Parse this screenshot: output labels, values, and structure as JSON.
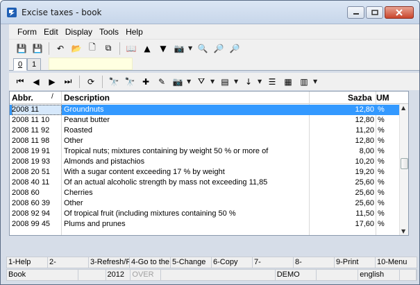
{
  "window": {
    "title": "Excise taxes - book"
  },
  "menu": [
    "Form",
    "Edit",
    "Display",
    "Tools",
    "Help"
  ],
  "toolbar1": [
    {
      "icon": "save-icon",
      "glyph": "💾",
      "enabled": false
    },
    {
      "icon": "save-as-icon",
      "glyph": "💾",
      "enabled": false
    },
    {
      "icon": "undo-icon",
      "glyph": "↶",
      "enabled": true
    },
    {
      "icon": "open-folder-icon",
      "glyph": "📂",
      "enabled": true
    },
    {
      "icon": "new-document-icon",
      "glyph": "🗋",
      "enabled": true
    },
    {
      "icon": "copy-icon",
      "glyph": "⧉",
      "enabled": true
    },
    {
      "icon": "book-icon",
      "glyph": "📖",
      "enabled": true
    },
    {
      "icon": "move-up-icon",
      "glyph": "▲",
      "enabled": true
    },
    {
      "icon": "move-down-icon",
      "glyph": "▼",
      "enabled": true
    },
    {
      "icon": "camera-icon",
      "glyph": "📷",
      "enabled": true
    },
    {
      "icon": "find-icon",
      "glyph": "🔍",
      "enabled": true
    },
    {
      "icon": "find-next-icon",
      "glyph": "🔎",
      "enabled": true
    },
    {
      "icon": "find-previous-icon",
      "glyph": "🔎",
      "enabled": true
    }
  ],
  "tabs": {
    "items": [
      "0",
      "1"
    ],
    "active": "0"
  },
  "toolbar2": [
    {
      "icon": "first-record-icon",
      "glyph": "⏮"
    },
    {
      "icon": "previous-record-icon",
      "glyph": "◀"
    },
    {
      "icon": "next-record-icon",
      "glyph": "▶"
    },
    {
      "icon": "last-record-icon",
      "glyph": "⏭"
    },
    {
      "icon": "refresh-icon",
      "glyph": "⟳"
    },
    {
      "icon": "binoculars-icon",
      "glyph": "🔭"
    },
    {
      "icon": "binoculars-disabled-icon",
      "glyph": "🔭"
    },
    {
      "icon": "add-record-icon",
      "glyph": "✚"
    },
    {
      "icon": "edit-record-icon",
      "glyph": "✎"
    },
    {
      "icon": "camera-icon",
      "glyph": "📷"
    },
    {
      "icon": "filter-icon",
      "glyph": "⛛"
    },
    {
      "icon": "columns-icon",
      "glyph": "▤"
    },
    {
      "icon": "sort-az-icon",
      "glyph": "↓"
    },
    {
      "icon": "list-icon",
      "glyph": "☰"
    },
    {
      "icon": "excel-export-icon",
      "glyph": "▦"
    },
    {
      "icon": "report-icon",
      "glyph": "▥"
    }
  ],
  "grid": {
    "columns": {
      "abbr": "Abbr.",
      "description": "Description",
      "sazba": "Sazba",
      "um": "UM"
    },
    "sort_marker": "/",
    "rows": [
      {
        "abbr": "2008 11",
        "description": "Groundnuts",
        "sazba": "12,80",
        "um": "%"
      },
      {
        "abbr": "2008 11 10",
        "description": "Peanut butter",
        "sazba": "12,80",
        "um": "%"
      },
      {
        "abbr": "2008 11 92",
        "description": "Roasted",
        "sazba": "11,20",
        "um": "%"
      },
      {
        "abbr": "2008 11 98",
        "description": "Other",
        "sazba": "12,80",
        "um": "%"
      },
      {
        "abbr": "2008 19 91",
        "description": "Tropical nuts; mixtures containing by weight 50 % or more of",
        "sazba": "8,00",
        "um": "%"
      },
      {
        "abbr": "2008 19 93",
        "description": "Almonds and pistachios",
        "sazba": "10,20",
        "um": "%"
      },
      {
        "abbr": "2008 20 51",
        "description": "With a sugar content exceeding 17 % by weight",
        "sazba": "19,20",
        "um": "%"
      },
      {
        "abbr": "2008 40 11",
        "description": "Of an actual alcoholic strength by mass not exceeding 11,85",
        "sazba": "25,60",
        "um": "%"
      },
      {
        "abbr": "2008 60",
        "description": "Cherries",
        "sazba": "25,60",
        "um": "%"
      },
      {
        "abbr": "2008 60 39",
        "description": "Other",
        "sazba": "25,60",
        "um": "%"
      },
      {
        "abbr": "2008 92 94",
        "description": "Of tropical fruit (including mixtures containing 50 %",
        "sazba": "11,50",
        "um": "%"
      },
      {
        "abbr": "2008 99 45",
        "description": "Plums and prunes",
        "sazba": "17,60",
        "um": "%"
      }
    ]
  },
  "fkeys": [
    "1-Help",
    "2-",
    "3-Refresh/F",
    "4-Go to the",
    "5-Change",
    "6-Copy",
    "7-",
    "8-",
    "9-Print",
    "10-Menu"
  ],
  "status": [
    "Book",
    "",
    "2012",
    "OVER",
    "",
    "DEMO",
    "",
    "english",
    ""
  ]
}
